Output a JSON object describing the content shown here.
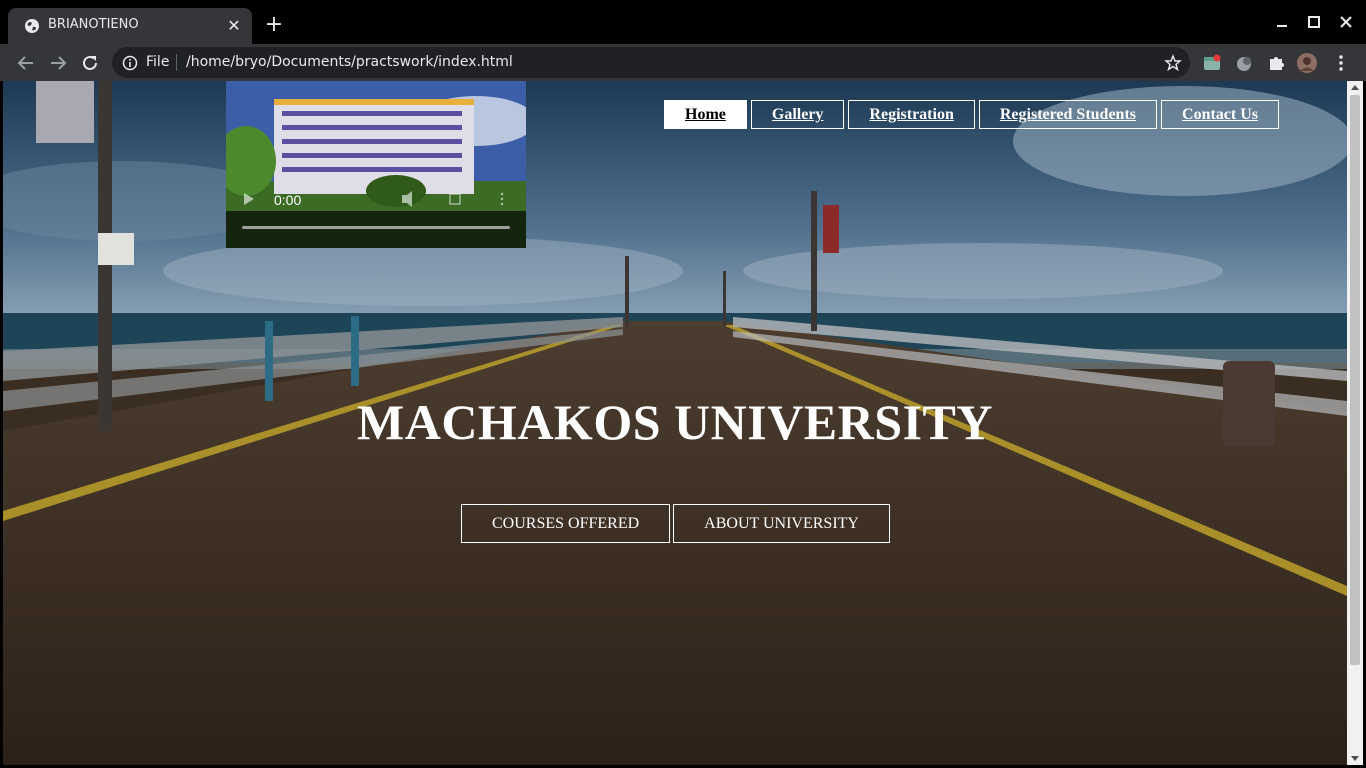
{
  "browser": {
    "tab_title": "BRIANOTIENO",
    "new_tab_label": "+",
    "address_scheme": "File",
    "address_url": "/home/bryo/Documents/practswork/index.html"
  },
  "video": {
    "time": "0:00"
  },
  "nav": {
    "items": [
      {
        "label": "Home",
        "active": true
      },
      {
        "label": "Gallery"
      },
      {
        "label": "Registration"
      },
      {
        "label": "Registered Students"
      },
      {
        "label": "Contact Us"
      }
    ]
  },
  "hero": {
    "title": "MACHAKOS UNIVERSITY",
    "buttons": [
      "COURSES OFFERED",
      "ABOUT UNIVERSITY"
    ]
  },
  "colors": {
    "chrome_dark": "#000000",
    "toolbar": "#35363a",
    "omnibox": "#202124",
    "nav_active_bg": "#ffffff"
  }
}
